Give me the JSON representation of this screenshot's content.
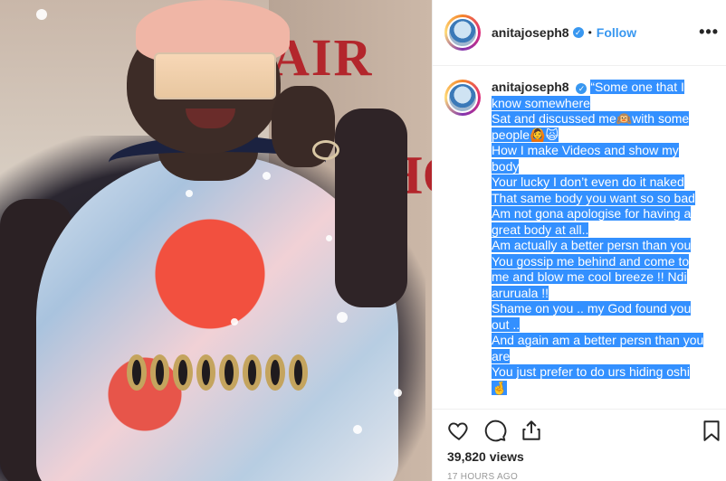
{
  "post": {
    "username": "anitajoseph8",
    "follow_label": "Follow",
    "dot": "•",
    "more_label": "•••",
    "verified_mark": "✓",
    "caption_lines": [
      "“Some one that I",
      "know somewhere",
      "Sat and discussed me🙉with some",
      "people🙆🙀",
      "How I make Videos and show my",
      "body",
      "Your lucky I don’t even do it naked",
      "That same body you want so so bad",
      "Am not gona apologise for having a",
      "great body at all..",
      "Am actually a better persn than you",
      "You gossip me behind and come to",
      "me and blow me cool breeze !! Ndi",
      "aruruala !!",
      "Shame on you .. my God found you",
      "out ..",
      "And again am a better persn than you",
      "are",
      "You just prefer to do urs hiding oshi",
      "🤞"
    ],
    "views": "39,820 views",
    "timestamp": "17 HOURS AGO"
  },
  "media": {
    "sign_text_top": "AIR",
    "sign_text_side": "HO"
  },
  "icons": {
    "like": "heart-icon",
    "comment": "comment-icon",
    "share": "share-icon",
    "save": "bookmark-icon"
  },
  "colors": {
    "accent": "#3897f0",
    "selection": "#3390ff",
    "text": "#262626",
    "muted": "#999999"
  }
}
